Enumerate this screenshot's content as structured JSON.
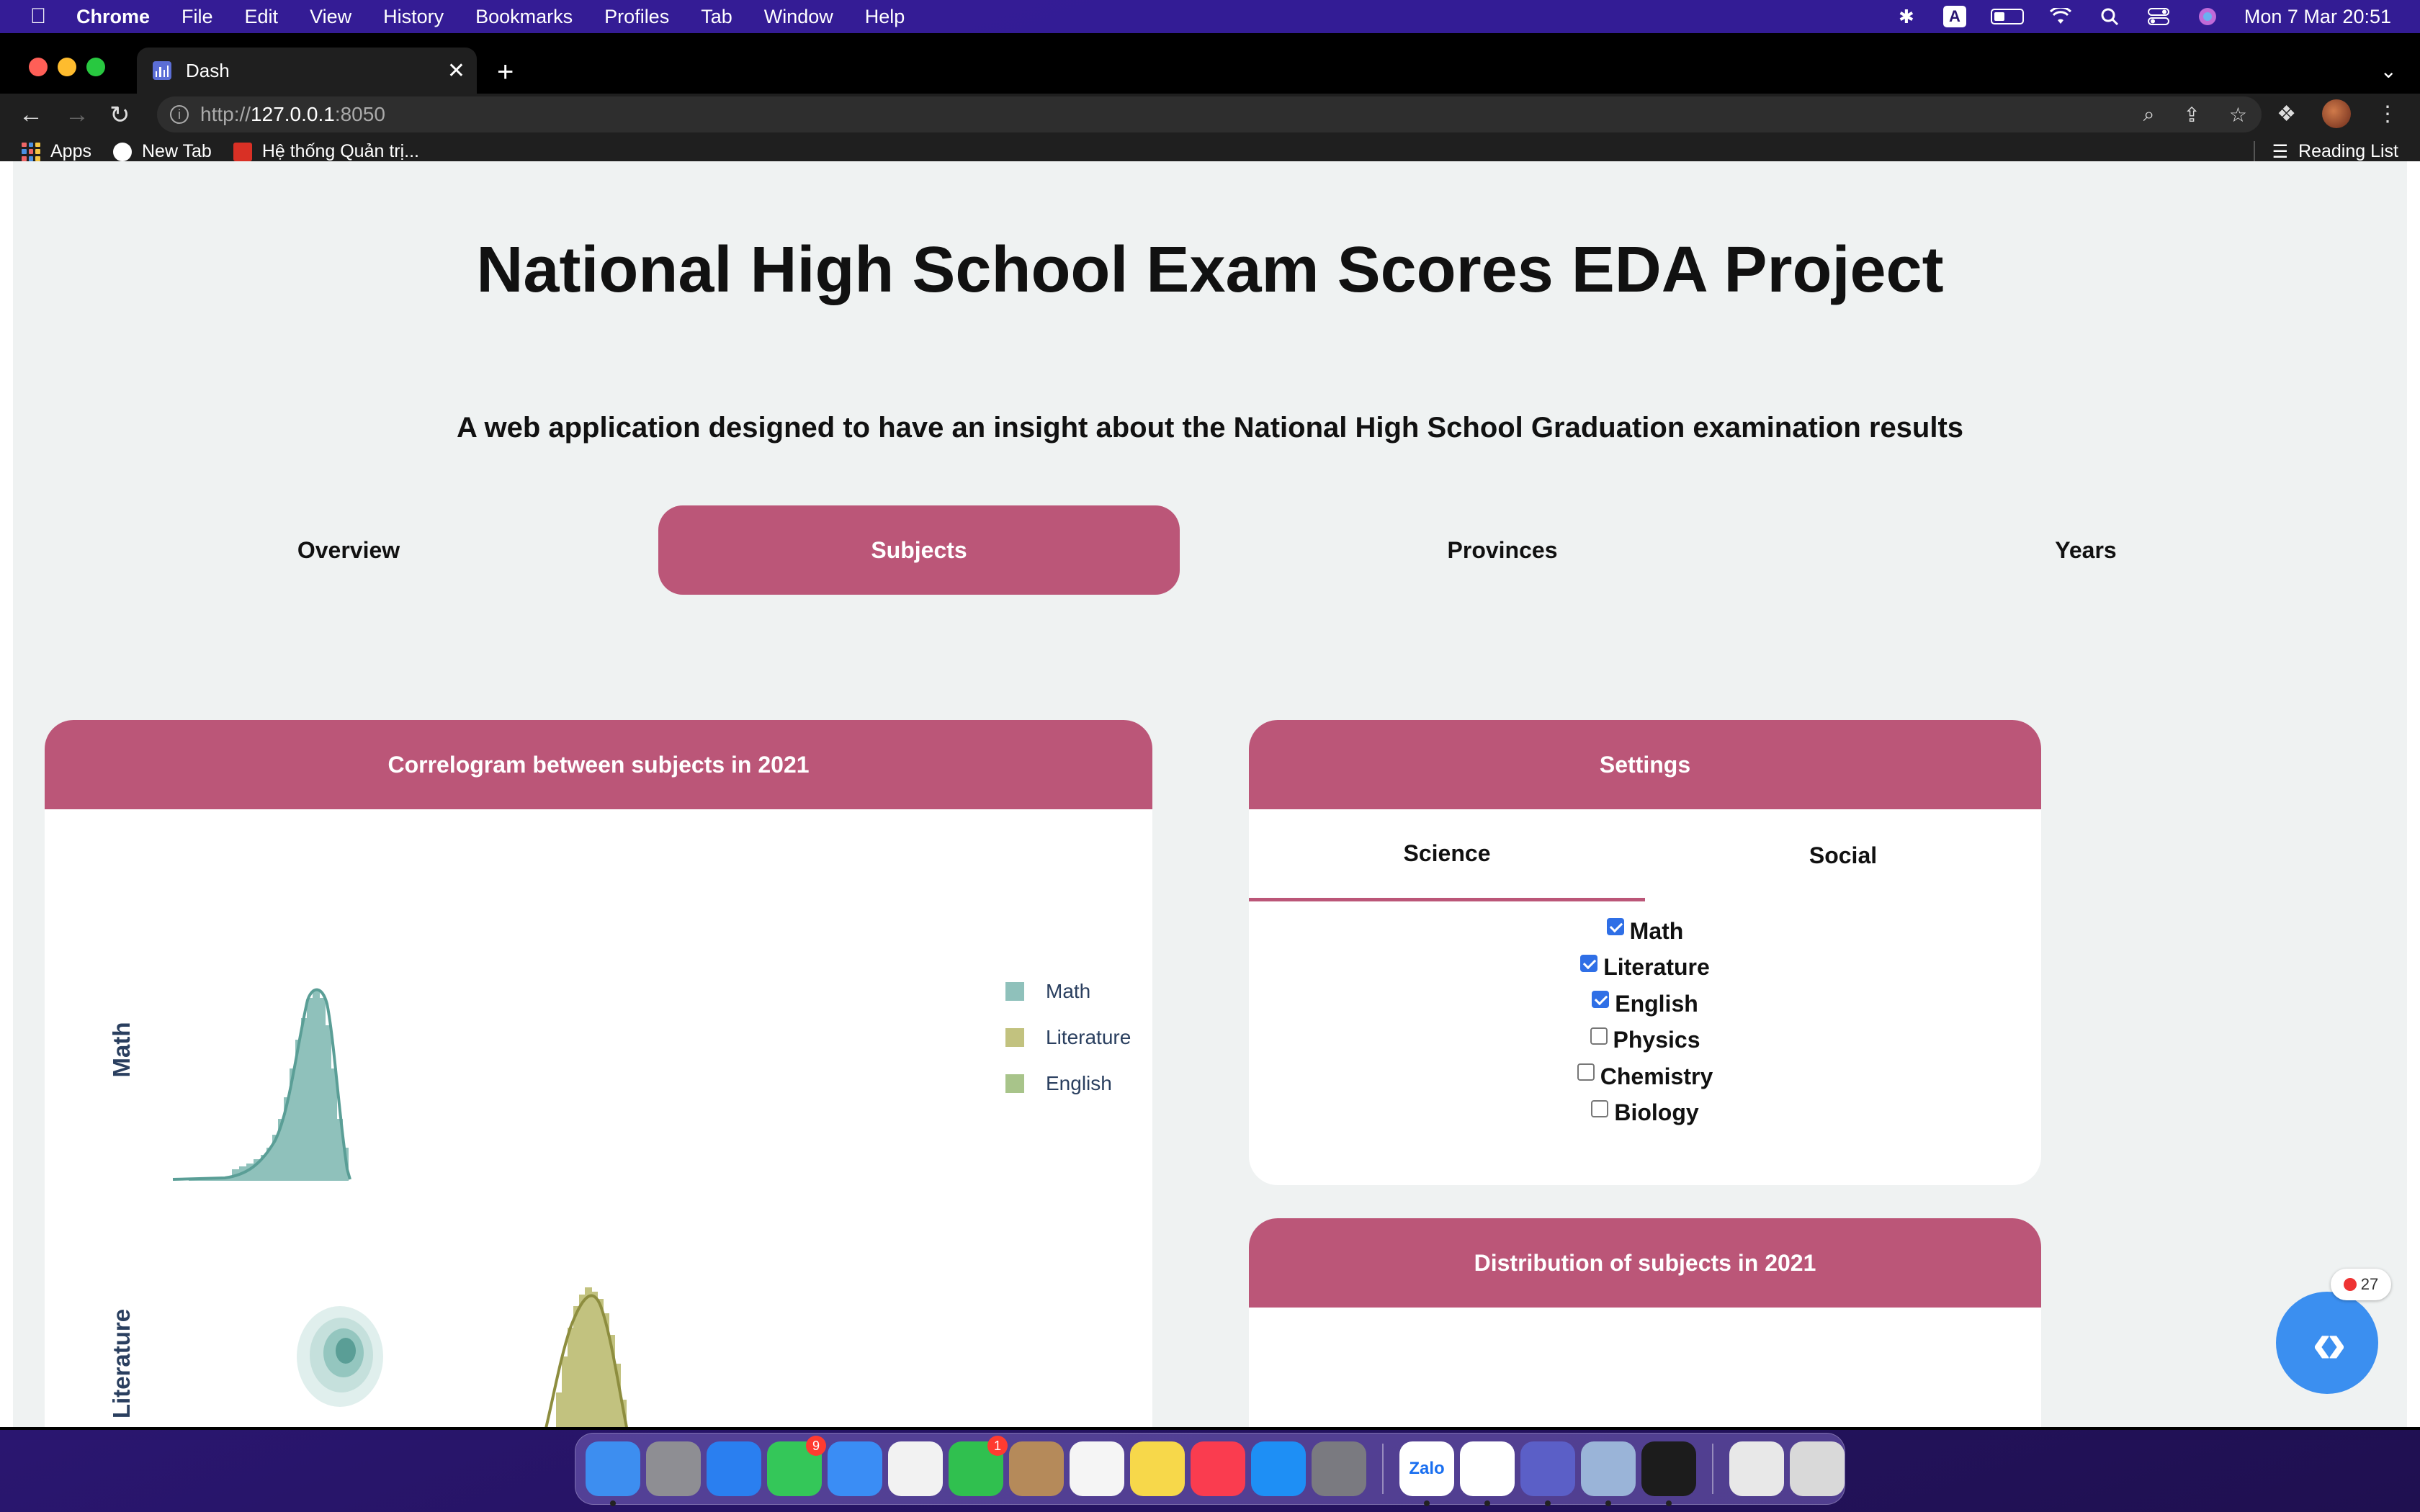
{
  "menubar": {
    "app": "Chrome",
    "items": [
      "File",
      "Edit",
      "View",
      "History",
      "Bookmarks",
      "Profiles",
      "Tab",
      "Window",
      "Help"
    ],
    "clock": "Mon 7 Mar  20:51",
    "input_source": "A"
  },
  "browser": {
    "tab_title": "Dash",
    "url_prefix": "http://",
    "url_host": "127.0.0.1",
    "url_port": ":8050",
    "bookmarks": [
      "Apps",
      "New Tab",
      "Hệ thống Quản trị..."
    ],
    "reading_list": "Reading List"
  },
  "page": {
    "title": "National High School Exam Scores EDA Project",
    "subtitle": "A web application designed to have an insight about the National High School Graduation examination results",
    "tabs": [
      {
        "label": "Overview",
        "active": false
      },
      {
        "label": "Subjects",
        "active": true
      },
      {
        "label": "Provinces",
        "active": false
      },
      {
        "label": "Years",
        "active": false
      }
    ],
    "accent_color": "#bb5678"
  },
  "correlogram": {
    "title": "Correlogram between subjects in 2021",
    "legend": [
      {
        "name": "Math",
        "color": "#8fc1bb"
      },
      {
        "name": "Literature",
        "color": "#c2c27f"
      },
      {
        "name": "English",
        "color": "#a8c48a"
      }
    ],
    "row_labels": [
      "Math",
      "Literature"
    ]
  },
  "settings": {
    "title": "Settings",
    "subtabs": [
      {
        "label": "Science",
        "active": true
      },
      {
        "label": "Social",
        "active": false
      }
    ],
    "checkboxes": [
      {
        "label": "Math",
        "checked": true
      },
      {
        "label": "Literature",
        "checked": true
      },
      {
        "label": "English",
        "checked": true
      },
      {
        "label": "Physics",
        "checked": false
      },
      {
        "label": "Chemistry",
        "checked": false
      },
      {
        "label": "Biology",
        "checked": false
      }
    ]
  },
  "distribution": {
    "title": "Distribution of subjects in 2021"
  },
  "fab": {
    "badge_count": "27"
  },
  "dock": {
    "apps": [
      {
        "name": "Finder",
        "color": "#3d8ef0",
        "badge": null
      },
      {
        "name": "Launchpad",
        "color": "#8e8e93",
        "badge": null
      },
      {
        "name": "Safari",
        "color": "#2a7ff0",
        "badge": null
      },
      {
        "name": "Messages",
        "color": "#34c759",
        "badge": "9"
      },
      {
        "name": "Mail",
        "color": "#3a8df5",
        "badge": null
      },
      {
        "name": "Photos",
        "color": "#f2f2f2",
        "badge": null
      },
      {
        "name": "FaceTime",
        "color": "#30c04f",
        "badge": "1"
      },
      {
        "name": "Contacts",
        "color": "#b58a5a",
        "badge": null
      },
      {
        "name": "Reminders",
        "color": "#f5f5f5",
        "badge": null
      },
      {
        "name": "Notes",
        "color": "#f7d84a",
        "badge": null
      },
      {
        "name": "Music",
        "color": "#fa3c4f",
        "badge": null
      },
      {
        "name": "App Store",
        "color": "#1e8ff5",
        "badge": null
      },
      {
        "name": "System Preferences",
        "color": "#7a7a80",
        "badge": null
      },
      {
        "name": "Zalo",
        "color": "#ffffff",
        "badge": null,
        "label": "Zalo"
      },
      {
        "name": "Chrome",
        "color": "#ffffff",
        "badge": null
      },
      {
        "name": "Teams",
        "color": "#5b5fc7",
        "badge": null
      },
      {
        "name": "Preview",
        "color": "#9ab4d8",
        "badge": null
      },
      {
        "name": "Terminal",
        "color": "#1c1c1c",
        "badge": null
      },
      {
        "name": "Documents",
        "color": "#e8e8e8",
        "badge": null
      },
      {
        "name": "Trash",
        "color": "#d9d9d9",
        "badge": null
      }
    ]
  }
}
